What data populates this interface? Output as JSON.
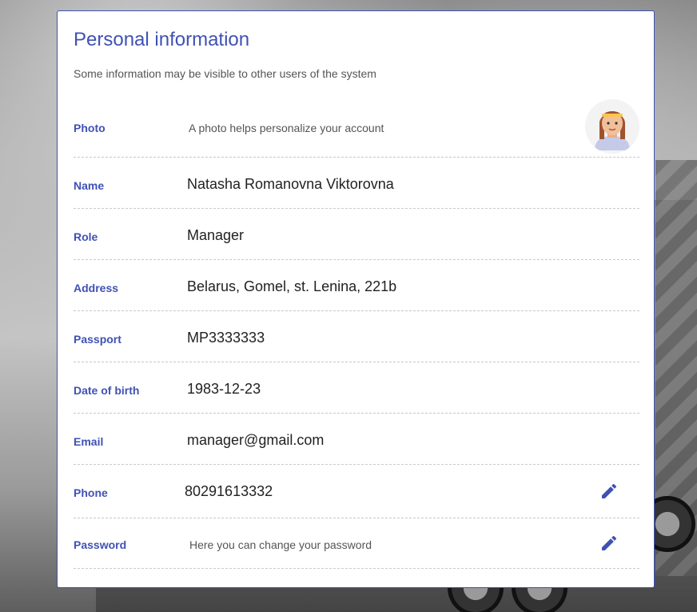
{
  "card": {
    "title": "Personal information",
    "subtitle": "Some information may be visible to other users of the system"
  },
  "fields": {
    "photo": {
      "label": "Photo",
      "hint": "A photo helps personalize your account"
    },
    "name": {
      "label": "Name",
      "value": "Natasha Romanovna Viktorovna"
    },
    "role": {
      "label": "Role",
      "value": "Manager"
    },
    "address": {
      "label": "Address",
      "value": "Belarus, Gomel, st. Lenina, 221b"
    },
    "passport": {
      "label": "Passport",
      "value": "MP3333333"
    },
    "date_of_birth": {
      "label": "Date of birth",
      "value": "1983-12-23"
    },
    "email": {
      "label": "Email",
      "value": "manager@gmail.com"
    },
    "phone": {
      "label": "Phone",
      "value": "80291613332",
      "action_icon": "edit-pencil-icon"
    },
    "password": {
      "label": "Password",
      "hint": "Here you can change your password",
      "action_icon": "edit-pencil-icon"
    }
  },
  "colors": {
    "accent": "#3f51b5",
    "divider": "#c8c8c8"
  }
}
